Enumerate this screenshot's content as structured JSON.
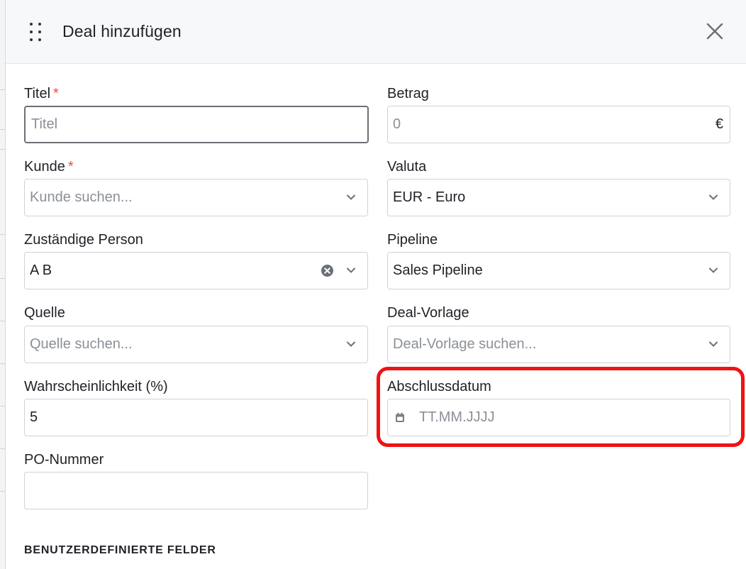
{
  "modal": {
    "title": "Deal hinzufügen"
  },
  "fields": {
    "titel": {
      "label": "Titel",
      "required_mark": "*",
      "placeholder": "Titel"
    },
    "betrag": {
      "label": "Betrag",
      "value": "0",
      "currency_symbol": "€"
    },
    "kunde": {
      "label": "Kunde",
      "required_mark": "*",
      "placeholder": "Kunde suchen..."
    },
    "valuta": {
      "label": "Valuta",
      "value": "EUR - Euro"
    },
    "zustaendige_person": {
      "label": "Zuständige Person",
      "value": "A B"
    },
    "pipeline": {
      "label": "Pipeline",
      "value": "Sales Pipeline"
    },
    "quelle": {
      "label": "Quelle",
      "placeholder": "Quelle suchen..."
    },
    "deal_vorlage": {
      "label": "Deal-Vorlage",
      "placeholder": "Deal-Vorlage suchen..."
    },
    "wahrscheinlichkeit": {
      "label": "Wahrscheinlichkeit (%)",
      "value": "5"
    },
    "abschlussdatum": {
      "label": "Abschlussdatum",
      "placeholder": "TT.MM.JJJJ"
    },
    "po_nummer": {
      "label": "PO-Nummer",
      "value": ""
    }
  },
  "sections": {
    "custom_fields_title": "BENUTZERDEFINIERTE FELDER"
  },
  "colors": {
    "required": "#e0553a",
    "highlight": "#f01212",
    "border": "#cfd3d8",
    "placeholder": "#8b9097"
  },
  "icons": {
    "drag": "drag-handle-icon",
    "close": "close-icon",
    "chevron": "chevron-down-icon",
    "clear": "clear-circle-icon",
    "calendar": "calendar-icon"
  }
}
